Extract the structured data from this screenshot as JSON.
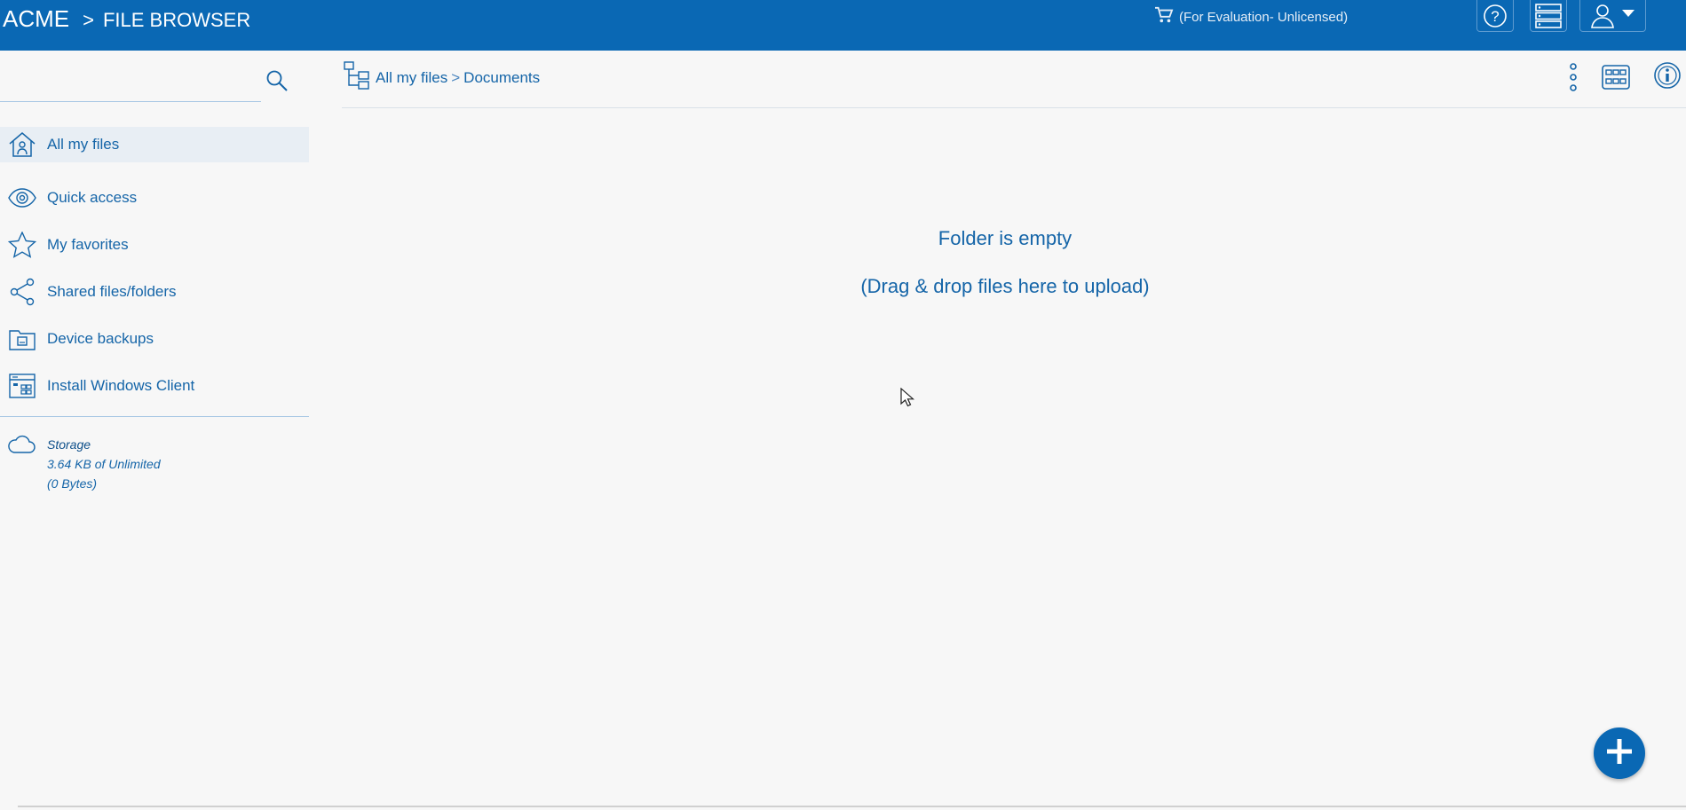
{
  "header": {
    "brand": "ACME",
    "separator": ">",
    "section": "FILE BROWSER",
    "license_text": "(For Evaluation- Unlicensed)",
    "icons": [
      "cart-icon",
      "help-icon",
      "server-icon",
      "user-menu-icon"
    ]
  },
  "sidebar": {
    "search_placeholder": "",
    "items": [
      {
        "label": "All my files",
        "icon": "home-icon",
        "active": true
      },
      {
        "label": "Quick access",
        "icon": "eye-icon"
      },
      {
        "label": "My favorites",
        "icon": "star-icon"
      },
      {
        "label": "Shared files/folders",
        "icon": "share-icon"
      },
      {
        "label": "Device backups",
        "icon": "backup-icon"
      },
      {
        "label": "Install Windows Client",
        "icon": "windows-client-icon"
      }
    ],
    "storage": {
      "title": "Storage",
      "usage": "3.64 KB of Unlimited",
      "bytes": "(0 Bytes)"
    }
  },
  "breadcrumb": {
    "root": "All my files",
    "separator": ">",
    "current": "Documents"
  },
  "main": {
    "empty_title": "Folder is empty",
    "empty_hint": "(Drag & drop files here to upload)"
  },
  "colors": {
    "header_bg": "#0a68b4",
    "accent": "#1565a8",
    "background": "#f7f7f7"
  }
}
